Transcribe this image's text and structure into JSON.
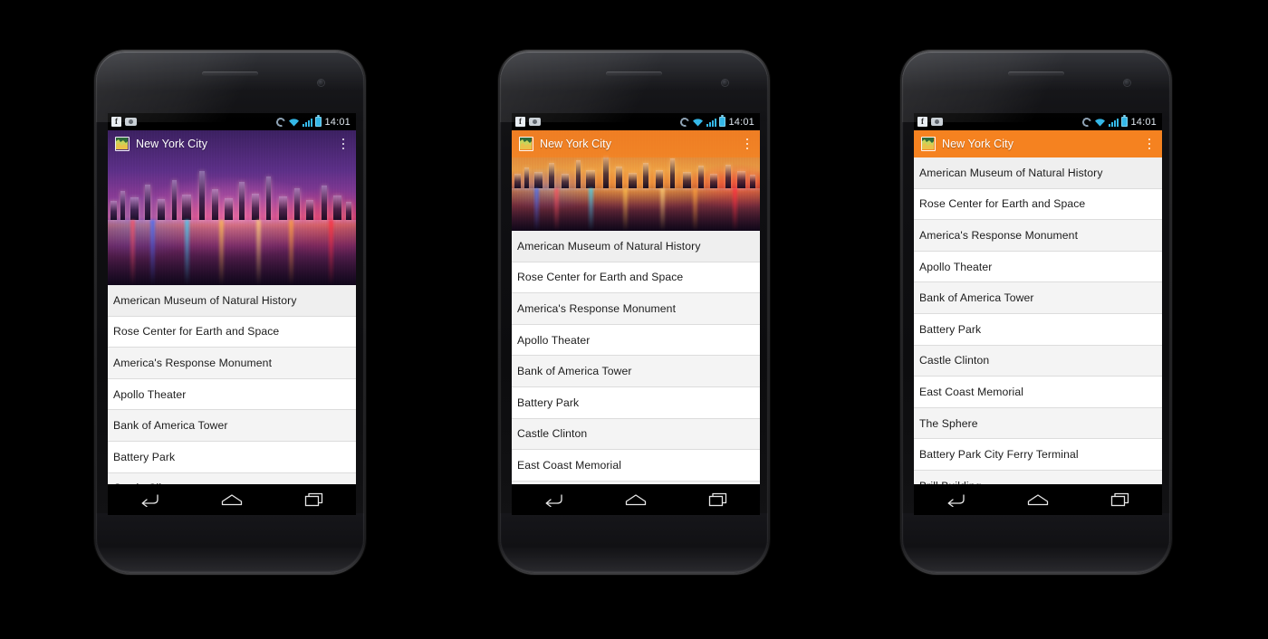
{
  "scene": {
    "background_color": "#000000",
    "description": "Three Android phones showing a New York City landmarks app with three app bar styles"
  },
  "status_bar": {
    "time": "14:01",
    "left_icons": [
      "facebook-icon",
      "camera-icon"
    ],
    "right_icons": [
      "sync-icon",
      "wifi-icon",
      "signal-icon",
      "battery-icon"
    ],
    "background_color": "#000000",
    "time_color": "#dfe7ef",
    "accent_color": "#35b8e8"
  },
  "app_bar": {
    "title": "New York City",
    "app_icon": "globe-map-icon",
    "overflow_menu": "more-options-icon",
    "orange": "#F58220",
    "title_color": "#ffffff"
  },
  "nav_bar": {
    "back": "back-icon",
    "home": "home-icon",
    "recents": "recents-icon",
    "background_color": "#000000"
  },
  "list": {
    "divider_color": "#dcdcdc",
    "row_bg": "#f4f4f4",
    "text_color": "#1c1c1c",
    "items": [
      "American Museum of Natural History",
      "Rose Center for Earth and Space",
      "America's Response Monument",
      "Apollo Theater",
      "Bank of America Tower",
      "Battery Park",
      "Castle Clinton",
      "East Coast Memorial",
      "The Sphere",
      "Battery Park City Ferry Terminal",
      "Brill Building"
    ]
  },
  "phones": [
    {
      "id": "phone-1",
      "app_bar_style": "transparent",
      "hero": "nyc-skyline-purple",
      "hero_height": "tall",
      "visible_items": 7,
      "note": "Fully transparent app bar over hero photo"
    },
    {
      "id": "phone-2",
      "app_bar_style": "translucent",
      "hero": "nyc-skyline-orange",
      "hero_height": "short",
      "visible_items": 9,
      "note": "Semi-transparent orange app bar over hero photo"
    },
    {
      "id": "phone-3",
      "app_bar_style": "solid",
      "hero": "none",
      "hero_height": "none",
      "visible_items": 11,
      "note": "Solid orange app bar, no hero photo"
    }
  ]
}
